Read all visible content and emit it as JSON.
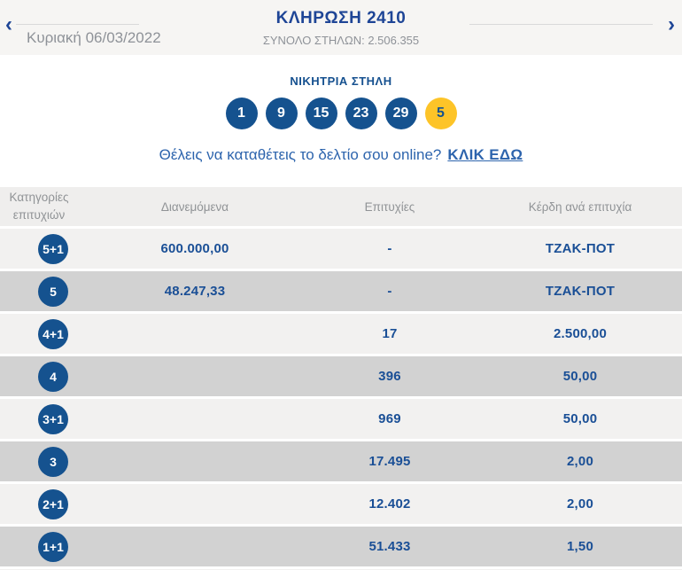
{
  "topbar": {
    "prev_arrow": "‹",
    "next_arrow": "›",
    "date": "Κυριακή 06/03/2022",
    "title": "ΚΛΗΡΩΣΗ 2410",
    "total_columns": "ΣΥΝΟΛΟ ΣΤΗΛΩΝ: 2.506.355"
  },
  "winning": {
    "label": "ΝΙΚΗΤΡΙΑ ΣΤΗΛΗ",
    "numbers": [
      "1",
      "9",
      "15",
      "23",
      "29"
    ],
    "bonus": "5"
  },
  "cta": {
    "question": "Θέλεις να καταθέτεις το δελτίο σου online?",
    "link_label": "ΚΛΙΚ ΕΔΩ"
  },
  "table": {
    "headers": [
      "Κατηγορίες επιτυχιών",
      "Διανεμόμενα",
      "Επιτυχίες",
      "Κέρδη ανά επιτυχία"
    ],
    "rows": [
      {
        "category": "5+1",
        "distributed": "600.000,00",
        "successes": "-",
        "winnings": "ΤΖΑΚ-ΠΟΤ"
      },
      {
        "category": "5",
        "distributed": "48.247,33",
        "successes": "-",
        "winnings": "ΤΖΑΚ-ΠΟΤ"
      },
      {
        "category": "4+1",
        "distributed": "",
        "successes": "17",
        "winnings": "2.500,00"
      },
      {
        "category": "4",
        "distributed": "",
        "successes": "396",
        "winnings": "50,00"
      },
      {
        "category": "3+1",
        "distributed": "",
        "successes": "969",
        "winnings": "50,00"
      },
      {
        "category": "3",
        "distributed": "",
        "successes": "17.495",
        "winnings": "2,00"
      },
      {
        "category": "2+1",
        "distributed": "",
        "successes": "12.402",
        "winnings": "2,00"
      },
      {
        "category": "1+1",
        "distributed": "",
        "successes": "51.433",
        "winnings": "1,50"
      }
    ]
  },
  "colors": {
    "title_navy": "#1e4596",
    "ball_blue": "#15528f",
    "bonus_yellow": "#fdc428",
    "value_navy": "#1a4f96",
    "link_blue": "#2d64ad",
    "row_light": "#f2f1f0",
    "row_dark": "#d2d2d2",
    "header_gray_bg": "#efeeed",
    "topbar_bg": "#f6f5f3"
  }
}
